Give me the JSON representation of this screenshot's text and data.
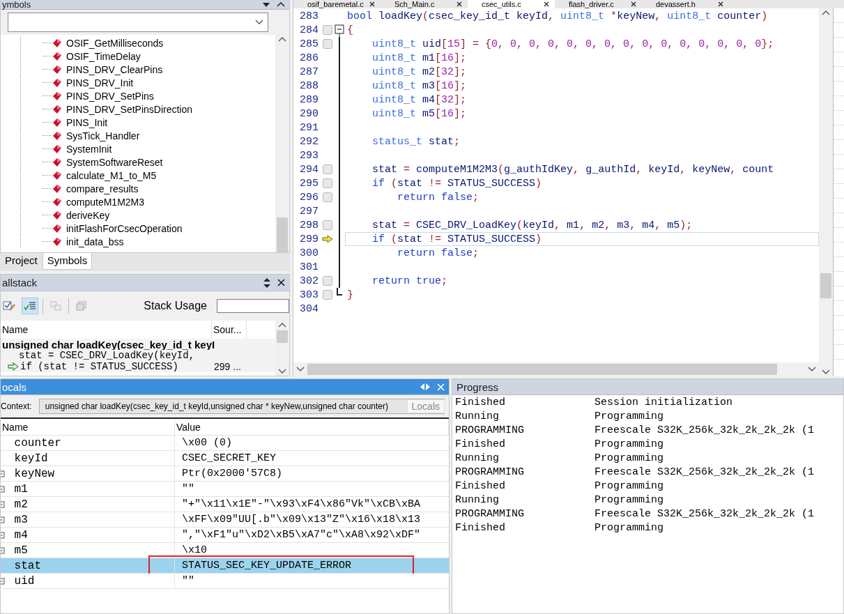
{
  "symbols_panel": {
    "title": "ymbols",
    "items": [
      {
        "label": "OSIF_GetMilliseconds",
        "selected": false
      },
      {
        "label": "OSIF_TimeDelay",
        "selected": false
      },
      {
        "label": "PINS_DRV_ClearPins",
        "selected": false
      },
      {
        "label": "PINS_DRV_Init",
        "selected": false
      },
      {
        "label": "PINS_DRV_SetPins",
        "selected": false
      },
      {
        "label": "PINS_DRV_SetPinsDirection",
        "selected": false
      },
      {
        "label": "PINS_Init",
        "selected": false
      },
      {
        "label": "SysTick_Handler",
        "selected": false
      },
      {
        "label": "SystemInit",
        "selected": false
      },
      {
        "label": "SystemSoftwareReset",
        "selected": false
      },
      {
        "label": "calculate_M1_to_M5",
        "selected": false
      },
      {
        "label": "compare_results",
        "selected": false
      },
      {
        "label": "computeM1M2M3",
        "selected": false
      },
      {
        "label": "deriveKey",
        "selected": false
      },
      {
        "label": "initFlashForCsecOperation",
        "selected": false
      },
      {
        "label": "init_data_bss",
        "selected": false
      }
    ]
  },
  "workspace_tabs": [
    {
      "label": "Project",
      "selected": false
    },
    {
      "label": "Symbols",
      "selected": true
    }
  ],
  "callstack": {
    "title": "allstack",
    "stack_usage_label": "Stack Usage",
    "columns": [
      "Name",
      "Sour..."
    ],
    "rows": [
      {
        "kind": "frame",
        "name": "unsigned char loadKey(csec_key_id_t keyI",
        "source": ""
      },
      {
        "kind": "source",
        "name": "stat = CSEC_DRV_LoadKey(keyId,",
        "source": ""
      },
      {
        "kind": "current",
        "name": "if (stat != STATUS_SUCCESS)",
        "source": "299 ..."
      }
    ]
  },
  "editor": {
    "tabs": [
      {
        "label": "osif_baremetal.c",
        "selected": false
      },
      {
        "label": "Sch_Main.c",
        "selected": false
      },
      {
        "label": "csec_utils.c",
        "selected": true
      },
      {
        "label": "flash_driver.c",
        "selected": false
      },
      {
        "label": "devassert.h",
        "selected": false
      }
    ],
    "lines": [
      {
        "number": "283",
        "current": false,
        "slot": false,
        "arrow": false,
        "fold_start": false,
        "in_fold": false,
        "fold_end": false,
        "segments": [
          {
            "kind": "keyword",
            "text": "bool"
          },
          {
            "kind": "ident",
            "text": " loadKey"
          },
          {
            "kind": "punct",
            "text": "("
          },
          {
            "kind": "ident",
            "text": "csec_key_id_t keyId"
          },
          {
            "kind": "punct",
            "text": ", "
          },
          {
            "kind": "type",
            "text": "uint8_t"
          },
          {
            "kind": "punct",
            "text": " *"
          },
          {
            "kind": "ident",
            "text": "keyNew"
          },
          {
            "kind": "punct",
            "text": ", "
          },
          {
            "kind": "type",
            "text": "uint8_t"
          },
          {
            "kind": "ident",
            "text": " counter"
          },
          {
            "kind": "punct",
            "text": ")"
          }
        ]
      },
      {
        "number": "284",
        "slot": true,
        "fold_start": true,
        "current": false,
        "segments": [
          {
            "kind": "punct",
            "text": "{"
          }
        ]
      },
      {
        "number": "285",
        "slot": true,
        "in_fold": true,
        "current": false,
        "segments": [
          {
            "kind": "type",
            "text": "    uint8_t"
          },
          {
            "kind": "ident",
            "text": " uid"
          },
          {
            "kind": "punct",
            "text": "["
          },
          {
            "kind": "number",
            "text": "15"
          },
          {
            "kind": "punct",
            "text": "] = {"
          },
          {
            "kind": "number",
            "text": "0, 0, 0, 0, 0, 0, 0, 0, 0, 0, 0, 0, 0, 0, 0"
          },
          {
            "kind": "punct",
            "text": "};"
          }
        ]
      },
      {
        "number": "286",
        "in_fold": true,
        "current": false,
        "segments": [
          {
            "kind": "type",
            "text": "    uint8_t"
          },
          {
            "kind": "ident",
            "text": " m1"
          },
          {
            "kind": "punct",
            "text": "["
          },
          {
            "kind": "number",
            "text": "16"
          },
          {
            "kind": "punct",
            "text": "];"
          }
        ]
      },
      {
        "number": "287",
        "in_fold": true,
        "current": false,
        "segments": [
          {
            "kind": "type",
            "text": "    uint8_t"
          },
          {
            "kind": "ident",
            "text": " m2"
          },
          {
            "kind": "punct",
            "text": "["
          },
          {
            "kind": "number",
            "text": "32"
          },
          {
            "kind": "punct",
            "text": "];"
          }
        ]
      },
      {
        "number": "288",
        "in_fold": true,
        "current": false,
        "segments": [
          {
            "kind": "type",
            "text": "    uint8_t"
          },
          {
            "kind": "ident",
            "text": " m3"
          },
          {
            "kind": "punct",
            "text": "["
          },
          {
            "kind": "number",
            "text": "16"
          },
          {
            "kind": "punct",
            "text": "];"
          }
        ]
      },
      {
        "number": "289",
        "in_fold": true,
        "current": false,
        "segments": [
          {
            "kind": "type",
            "text": "    uint8_t"
          },
          {
            "kind": "ident",
            "text": " m4"
          },
          {
            "kind": "punct",
            "text": "["
          },
          {
            "kind": "number",
            "text": "32"
          },
          {
            "kind": "punct",
            "text": "];"
          }
        ]
      },
      {
        "number": "290",
        "in_fold": true,
        "current": false,
        "segments": [
          {
            "kind": "type",
            "text": "    uint8_t"
          },
          {
            "kind": "ident",
            "text": " m5"
          },
          {
            "kind": "punct",
            "text": "["
          },
          {
            "kind": "number",
            "text": "16"
          },
          {
            "kind": "punct",
            "text": "];"
          }
        ]
      },
      {
        "number": "291",
        "in_fold": true,
        "current": false
      },
      {
        "number": "292",
        "in_fold": true,
        "current": false,
        "segments": [
          {
            "kind": "type",
            "text": "    status_t"
          },
          {
            "kind": "ident",
            "text": " stat"
          },
          {
            "kind": "punct",
            "text": ";"
          }
        ]
      },
      {
        "number": "293",
        "in_fold": true,
        "current": false
      },
      {
        "number": "294",
        "slot": true,
        "in_fold": true,
        "current": false,
        "segments": [
          {
            "kind": "ident",
            "text": "    stat "
          },
          {
            "kind": "punct",
            "text": "= "
          },
          {
            "kind": "ident",
            "text": "computeM1M2M3"
          },
          {
            "kind": "punct",
            "text": "("
          },
          {
            "kind": "ident",
            "text": "g_authIdKey"
          },
          {
            "kind": "punct",
            "text": ", "
          },
          {
            "kind": "ident",
            "text": "g_authId"
          },
          {
            "kind": "punct",
            "text": ", "
          },
          {
            "kind": "ident",
            "text": "keyId"
          },
          {
            "kind": "punct",
            "text": ", "
          },
          {
            "kind": "ident",
            "text": "keyNew"
          },
          {
            "kind": "punct",
            "text": ", "
          },
          {
            "kind": "ident",
            "text": "count"
          }
        ]
      },
      {
        "number": "295",
        "slot": true,
        "in_fold": true,
        "current": false,
        "segments": [
          {
            "kind": "keyword",
            "text": "    if"
          },
          {
            "kind": "punct",
            "text": " ("
          },
          {
            "kind": "ident",
            "text": "stat "
          },
          {
            "kind": "punct",
            "text": "!= "
          },
          {
            "kind": "ident",
            "text": "STATUS_SUCCESS"
          },
          {
            "kind": "punct",
            "text": ")"
          }
        ]
      },
      {
        "number": "296",
        "slot": true,
        "in_fold": true,
        "current": false,
        "segments": [
          {
            "kind": "keyword",
            "text": "        return false"
          },
          {
            "kind": "punct",
            "text": ";"
          }
        ]
      },
      {
        "number": "297",
        "in_fold": true,
        "current": false
      },
      {
        "number": "298",
        "slot": true,
        "in_fold": true,
        "current": false,
        "segments": [
          {
            "kind": "ident",
            "text": "    stat "
          },
          {
            "kind": "punct",
            "text": "= "
          },
          {
            "kind": "ident",
            "text": "CSEC_DRV_LoadKey"
          },
          {
            "kind": "punct",
            "text": "("
          },
          {
            "kind": "ident",
            "text": "keyId"
          },
          {
            "kind": "punct",
            "text": ", "
          },
          {
            "kind": "ident",
            "text": "m1"
          },
          {
            "kind": "punct",
            "text": ", "
          },
          {
            "kind": "ident",
            "text": "m2"
          },
          {
            "kind": "punct",
            "text": ", "
          },
          {
            "kind": "ident",
            "text": "m3"
          },
          {
            "kind": "punct",
            "text": ", "
          },
          {
            "kind": "ident",
            "text": "m4"
          },
          {
            "kind": "punct",
            "text": ", "
          },
          {
            "kind": "ident",
            "text": "m5"
          },
          {
            "kind": "punct",
            "text": ");"
          }
        ]
      },
      {
        "number": "299",
        "arrow": true,
        "in_fold": true,
        "current": true,
        "segments": [
          {
            "kind": "keyword",
            "text": "    if"
          },
          {
            "kind": "punct",
            "text": " ("
          },
          {
            "kind": "ident",
            "text": "stat "
          },
          {
            "kind": "punct",
            "text": "!= "
          },
          {
            "kind": "ident",
            "text": "STATUS_SUCCESS"
          },
          {
            "kind": "punct",
            "text": ")"
          }
        ]
      },
      {
        "number": "300",
        "in_fold": true,
        "current": false,
        "segments": [
          {
            "kind": "keyword",
            "text": "        return false"
          },
          {
            "kind": "punct",
            "text": ";"
          }
        ]
      },
      {
        "number": "301",
        "in_fold": true,
        "current": false
      },
      {
        "number": "302",
        "slot": true,
        "in_fold": true,
        "current": false,
        "segments": [
          {
            "kind": "keyword",
            "text": "    return true"
          },
          {
            "kind": "punct",
            "text": ";"
          }
        ]
      },
      {
        "number": "303",
        "slot": true,
        "fold_end": true,
        "current": false,
        "segments": [
          {
            "kind": "punct",
            "text": "}"
          }
        ]
      },
      {
        "number": "304",
        "current": false
      }
    ]
  },
  "locals": {
    "title": "ocals",
    "context_label": "Context:",
    "context_value": "unsigned char loadKey(csec_key_id_t keyId,unsigned char * keyNew,unsigned char counter)",
    "tooltip": "Locals",
    "columns": [
      "Name",
      "Value"
    ],
    "rows": [
      {
        "name": "counter",
        "value": "\\x00 (0)",
        "expandable": false,
        "selected": false,
        "annotated": false
      },
      {
        "name": "keyId",
        "value": "CSEC_SECRET_KEY",
        "expandable": false,
        "selected": false,
        "annotated": false
      },
      {
        "name": "keyNew",
        "value": "Ptr(0x2000'57C8)",
        "expandable": true,
        "selected": false,
        "annotated": false
      },
      {
        "name": "m1",
        "value": "\"\"",
        "expandable": true,
        "selected": false,
        "annotated": false
      },
      {
        "name": "m2",
        "value": "\"+\"\\x11\\x1E\"-\"\\x93\\xF4\\x86\"Vk\"\\xCB\\xBA",
        "expandable": true,
        "selected": false,
        "annotated": false
      },
      {
        "name": "m3",
        "value": "\\xFF\\x09\"UU[.b\"\\x09\\x13\"Z\"\\x16\\x18\\x13",
        "expandable": true,
        "selected": false,
        "annotated": false
      },
      {
        "name": "m4",
        "value": "\",\"\\xF1\"u\"\\xD2\\xB5\\xA7\"c\"\\xA8\\x92\\xDF\"",
        "expandable": true,
        "selected": false,
        "annotated": false
      },
      {
        "name": "m5",
        "value": "\\x10",
        "expandable": true,
        "selected": false,
        "annotated": false
      },
      {
        "name": "stat",
        "value": "STATUS_SEC_KEY_UPDATE_ERROR",
        "expandable": false,
        "selected": true,
        "annotated": true
      },
      {
        "name": "uid",
        "value": "\"\"",
        "expandable": true,
        "selected": false,
        "annotated": false
      }
    ]
  },
  "progress": {
    "title": "Progress",
    "rows": [
      {
        "status": "Finished",
        "task": "Session initialization"
      },
      {
        "status": "Running",
        "task": "Programming"
      },
      {
        "status": "PROGRAMMING",
        "task": "Freescale S32K_256k_32k_2k_2k_2k (1"
      },
      {
        "status": "Finished",
        "task": "Programming"
      },
      {
        "status": "Running",
        "task": "Programming"
      },
      {
        "status": "PROGRAMMING",
        "task": "Freescale S32K_256k_32k_2k_2k_2k (1"
      },
      {
        "status": "Finished",
        "task": "Programming"
      },
      {
        "status": "Running",
        "task": "Programming"
      },
      {
        "status": "PROGRAMMING",
        "task": "Freescale S32K_256k_32k_2k_2k_2k (1"
      },
      {
        "status": "Finished",
        "task": "Programming"
      }
    ]
  }
}
